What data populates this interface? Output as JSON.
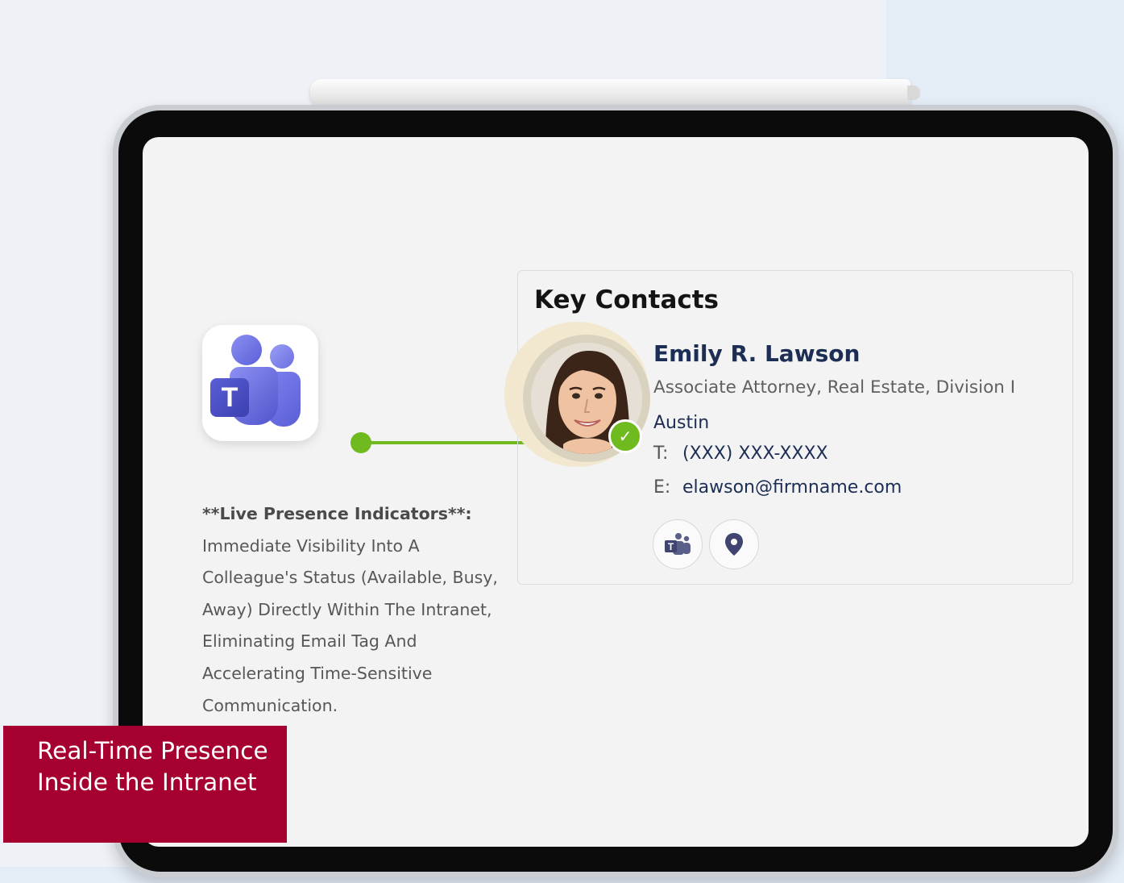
{
  "feature": {
    "title": "**Live Presence Indicators**:",
    "description": "Immediate Visibility Into A Colleague's Status (Available, Busy, Away) Directly Within The Intranet, Eliminating Email Tag And Accelerating Time-Sensitive Communication."
  },
  "card": {
    "heading": "Key Contacts",
    "contact": {
      "name": "Emily R. Lawson",
      "title": "Associate Attorney, Real Estate, Division I",
      "city": "Austin",
      "phone_label": "T:",
      "phone": "(XXX) XXX-XXXX",
      "email_label": "E:",
      "email": "elawson@firmname.com",
      "presence": "available"
    },
    "actions": [
      {
        "icon": "teams-icon"
      },
      {
        "icon": "location-pin-icon"
      }
    ]
  },
  "caption": {
    "text": "Real-Time Presence Inside the Intranet"
  },
  "colors": {
    "presence_green": "#6fba1e",
    "caption_red": "#a5002f",
    "name_navy": "#1d2e55",
    "teams_purple": "#5b5fd6"
  }
}
